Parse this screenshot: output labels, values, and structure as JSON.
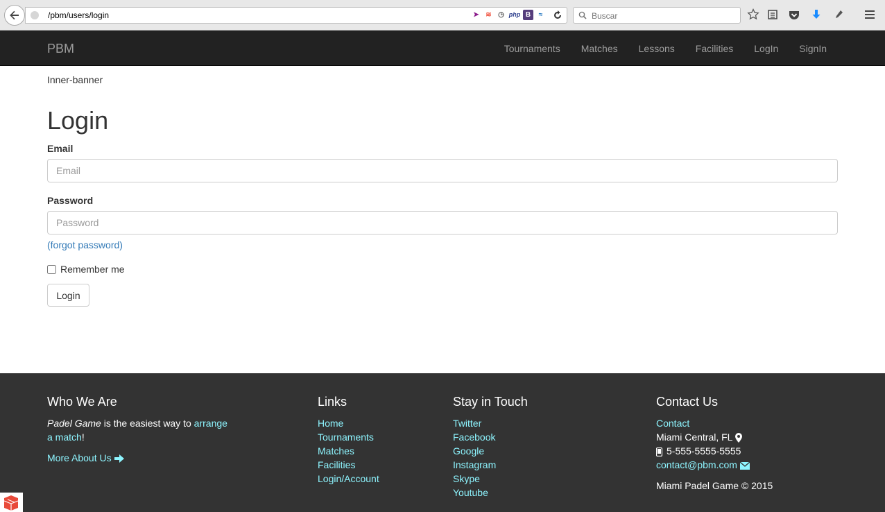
{
  "browser": {
    "url": "/pbm/users/login",
    "search_placeholder": "Buscar",
    "ext_icons": [
      "feather-icon",
      "laravel-icon",
      "clock-icon",
      "php-icon",
      "bootstrap-icon",
      "wave-icon"
    ]
  },
  "navbar": {
    "brand": "PBM",
    "links": [
      "Tournaments",
      "Matches",
      "Lessons",
      "Facilities",
      "LogIn",
      "SignIn"
    ]
  },
  "content": {
    "banner": "Inner-banner",
    "title": "Login",
    "email_label": "Email",
    "email_placeholder": "Email",
    "password_label": "Password",
    "password_placeholder": "Password",
    "forgot": "(forgot password)",
    "remember": "Remember me",
    "login_button": "Login"
  },
  "footer": {
    "who": {
      "heading": "Who We Are",
      "italic": "Padel Game",
      "text": " is the easiest way to ",
      "link": "arrange a match",
      "end": "!",
      "more": "More About Us"
    },
    "links": {
      "heading": "Links",
      "items": [
        "Home",
        "Tournaments",
        "Matches",
        "Facilities",
        "Login/Account"
      ]
    },
    "touch": {
      "heading": "Stay in Touch",
      "items": [
        "Twitter",
        "Facebook",
        "Google",
        "Instagram",
        "Skype",
        "Youtube"
      ]
    },
    "contact": {
      "heading": "Contact Us",
      "link": "Contact",
      "address": "Miami Central, FL",
      "phone": "5-555-5555-5555",
      "email": "contact@pbm.com",
      "copyright": "Miami Padel Game © 2015"
    }
  },
  "colors": {
    "navbar_bg": "#222222",
    "footer_bg": "#333333",
    "footer_link": "#8ef5ff",
    "link": "#337ab7"
  }
}
